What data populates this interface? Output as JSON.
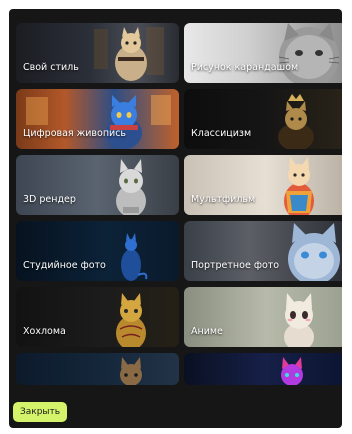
{
  "styles": [
    {
      "label": "Свой стиль",
      "icon": "ninja-cat-image",
      "accent": "#e2c89a"
    },
    {
      "label": "Рисунок карандашом",
      "icon": "pencil-cat-image",
      "accent": "#bdbdbd"
    },
    {
      "label": "Цифровая живопись",
      "icon": "digital-painting-cat-image",
      "accent": "#3a7fe0"
    },
    {
      "label": "Классицизм",
      "icon": "classicism-cat-image",
      "accent": "#d6b35a"
    },
    {
      "label": "3D рендер",
      "icon": "render-3d-cat-image",
      "accent": "#d9d9d9"
    },
    {
      "label": "Мультфильм",
      "icon": "cartoon-cat-image",
      "accent": "#f0a23a"
    },
    {
      "label": "Студийное фото",
      "icon": "studio-photo-cat-image",
      "accent": "#2f6fd1"
    },
    {
      "label": "Портретное фото",
      "icon": "portrait-photo-cat-image",
      "accent": "#9fb7d6"
    },
    {
      "label": "Хохлома",
      "icon": "khokhloma-cat-image",
      "accent": "#d4a640"
    },
    {
      "label": "Аниме",
      "icon": "anime-cat-image",
      "accent": "#f1eadf"
    },
    {
      "label": "",
      "icon": "cat-image",
      "accent": "#8a6a45"
    },
    {
      "label": "",
      "icon": "neon-cat-image",
      "accent": "#b13ae0"
    }
  ],
  "footer": {
    "close_label": "Закрыть",
    "close_color": "#d4f36b"
  }
}
